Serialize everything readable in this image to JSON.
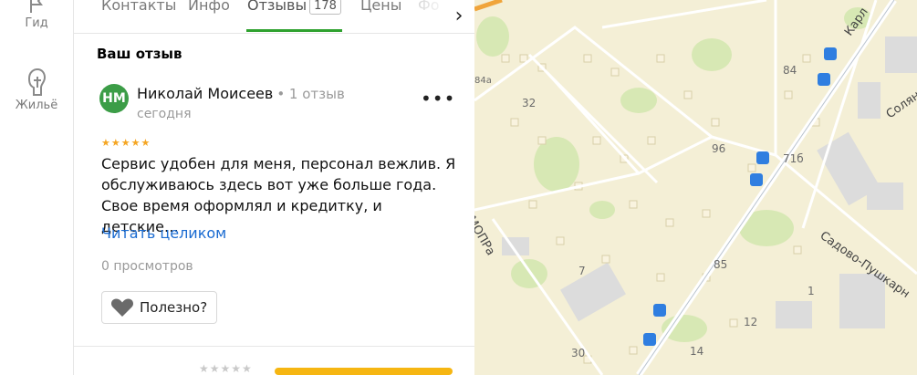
{
  "rail": {
    "items": [
      {
        "label": "Гид",
        "icon": "flag-icon"
      },
      {
        "label": "Жильё",
        "icon": "house-icon"
      }
    ]
  },
  "tabs": {
    "items": [
      {
        "label": "Контакты"
      },
      {
        "label": "Инфо"
      },
      {
        "label": "Отзывы",
        "count": "178",
        "active": true
      },
      {
        "label": "Цены"
      },
      {
        "label": "Фо"
      }
    ]
  },
  "review": {
    "section_title": "Ваш отзыв",
    "avatar_initials": "НМ",
    "avatar_color": "#3c9d47",
    "author": "Николай Моисеев",
    "author_meta": "• 1 отзыв",
    "date": "сегодня",
    "rating": 5,
    "stars": "★★★★★",
    "text": "Сервис удобен для меня, персонал вежлив. Я обслуживаюсь здесь вот уже больше года. Свое время оформлял и кредитку, и детские…",
    "read_more": "Читать целиком",
    "views": "0 просмотров",
    "useful": "Полезно?"
  },
  "bottom": {
    "stars": "★★★★★"
  },
  "map": {
    "labels": {
      "n84a": "84а",
      "n32": "32",
      "n96": "96",
      "n84": "84",
      "n71b": "71б",
      "n85": "85",
      "n7": "7",
      "n1": "1",
      "n12": "12",
      "n30": "30",
      "n14": "14",
      "street_karl": "Карл",
      "street_solyan": "Солян",
      "street_sadovo": "Садово-Пушкарн",
      "street_mopra": "МОПРа"
    }
  },
  "colors": {
    "accent_green": "#2ea12e",
    "link_blue": "#1a6bd1",
    "star_orange": "#f5a623",
    "map_bg": "#f4efd6",
    "bus_stop": "#2f7ee0"
  }
}
